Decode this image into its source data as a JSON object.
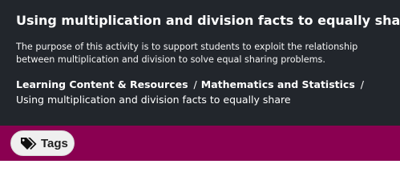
{
  "page": {
    "title": "Using multiplication and division facts to equally share",
    "description": "The purpose of this activity is to support students to exploit the relationship between multiplication and division to solve equal sharing problems."
  },
  "breadcrumb": {
    "items": [
      "Learning Content & Resources",
      "Mathematics and Statistics",
      "Using multiplication and division facts to equally share"
    ],
    "separator": "/"
  },
  "tags": {
    "label": "Tags",
    "icon": "tags-icon"
  },
  "colors": {
    "hero_bg": "#22262c",
    "tags_band": "#8a0051",
    "tag_button_bg": "#efefef"
  }
}
